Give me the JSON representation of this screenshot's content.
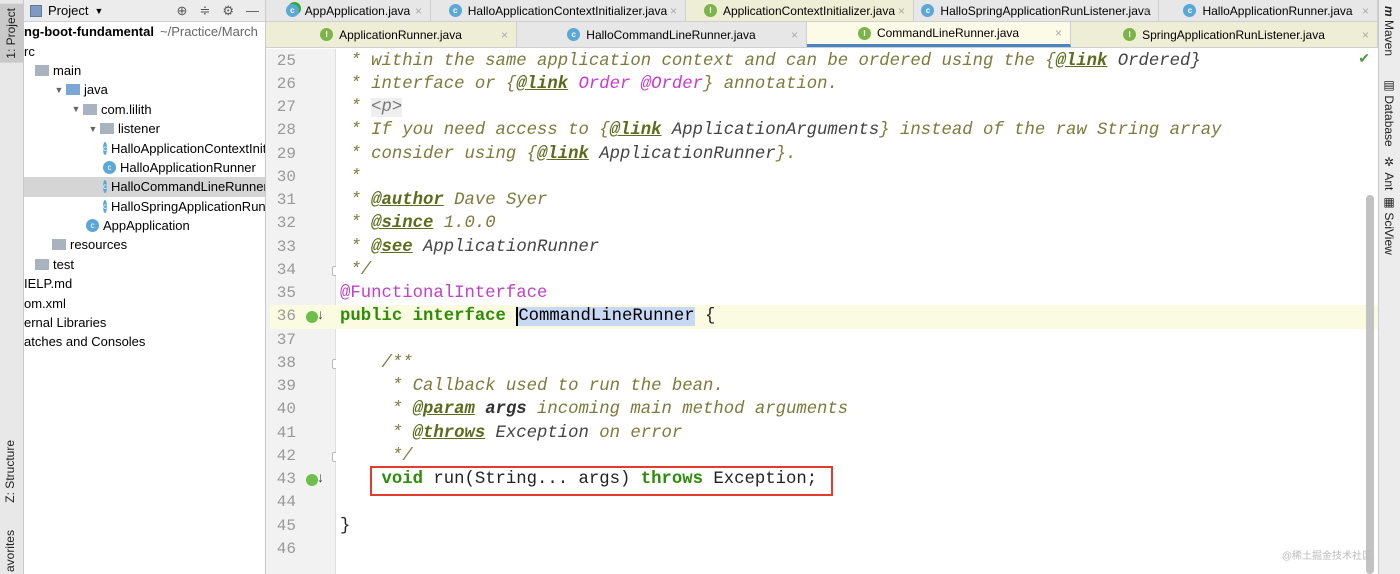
{
  "left_stripe": {
    "project": "1: Project",
    "structure": "Z: Structure",
    "favorites": "avorites"
  },
  "right_stripe": {
    "maven": "Maven",
    "database": "Database",
    "ant": "Ant",
    "sciview": "SciView"
  },
  "project_panel": {
    "title": "Project",
    "root": "ng-boot-fundamental",
    "root_path": "~/Practice/March",
    "items": [
      {
        "label": "rc",
        "indent": 0,
        "kind": "none"
      },
      {
        "label": "main",
        "indent": 1,
        "kind": "folder"
      },
      {
        "label": "java",
        "indent": 2,
        "kind": "folder-blue",
        "tri": "▼"
      },
      {
        "label": "com.lilith",
        "indent": 3,
        "kind": "folder",
        "tri": "▼"
      },
      {
        "label": "listener",
        "indent": 4,
        "kind": "folder",
        "tri": "▼"
      },
      {
        "label": "HalloApplicationContextInitializer",
        "indent": 5,
        "kind": "class"
      },
      {
        "label": "HalloApplicationRunner",
        "indent": 5,
        "kind": "class"
      },
      {
        "label": "HalloCommandLineRunner",
        "indent": 5,
        "kind": "class",
        "selected": true
      },
      {
        "label": "HalloSpringApplicationRunListener",
        "indent": 5,
        "kind": "class"
      },
      {
        "label": "AppApplication",
        "indent": 4,
        "kind": "app"
      },
      {
        "label": "resources",
        "indent": 2,
        "kind": "folder"
      },
      {
        "label": "test",
        "indent": 1,
        "kind": "folder"
      },
      {
        "label": "IELP.md",
        "indent": 0,
        "kind": "none"
      },
      {
        "label": "om.xml",
        "indent": 0,
        "kind": "none"
      },
      {
        "label": "ernal Libraries",
        "indent": 0,
        "kind": "none"
      },
      {
        "label": "atches and Consoles",
        "indent": 0,
        "kind": "none"
      }
    ]
  },
  "tabs_row1": [
    {
      "label": "AppApplication.java",
      "icon": "app",
      "width": 165
    },
    {
      "label": "HalloApplicationContextInitializer.java",
      "icon": "c",
      "width": 255
    },
    {
      "label": "ApplicationContextInitializer.java",
      "icon": "i",
      "width": 228,
      "iface": true
    },
    {
      "label": "HalloSpringApplicationRunListener.java",
      "icon": "c",
      "width": 245
    },
    {
      "label": "HalloApplicationRunner.java",
      "icon": "c",
      "width": 219
    }
  ],
  "tabs_row2": [
    {
      "label": "ApplicationRunner.java",
      "icon": "i",
      "width": 251,
      "iface": true
    },
    {
      "label": "HalloCommandLineRunner.java",
      "icon": "c",
      "width": 290
    },
    {
      "label": "CommandLineRunner.java",
      "icon": "i",
      "width": 264,
      "active": true
    },
    {
      "label": "SpringApplicationRunListener.java",
      "icon": "i",
      "width": 307,
      "iface": true
    }
  ],
  "editor": {
    "current_line": 36,
    "lines": [
      {
        "n": 25,
        "seg": [
          [
            " * within the same application context and can be ordered using the {",
            "cm"
          ],
          [
            "@link",
            "tag"
          ],
          [
            " Ordered}",
            "cmn"
          ]
        ]
      },
      {
        "n": 26,
        "seg": [
          [
            " * interface or {",
            "cm"
          ],
          [
            "@link",
            "tag"
          ],
          [
            " Order @Order",
            "ref"
          ],
          [
            "} annotation.",
            "cm"
          ]
        ]
      },
      {
        "n": 27,
        "seg": [
          [
            " * ",
            "cm"
          ],
          [
            "<p>",
            "html"
          ]
        ]
      },
      {
        "n": 28,
        "seg": [
          [
            " * If you need access to {",
            "cm"
          ],
          [
            "@link",
            "tag"
          ],
          [
            " ApplicationArguments",
            "cmn"
          ],
          [
            "} instead of the raw String array",
            "cm"
          ]
        ]
      },
      {
        "n": 29,
        "seg": [
          [
            " * consider using {",
            "cm"
          ],
          [
            "@link",
            "tag"
          ],
          [
            " ApplicationRunner",
            "cmn"
          ],
          [
            "}.",
            "cm"
          ]
        ]
      },
      {
        "n": 30,
        "seg": [
          [
            " *",
            "cm"
          ]
        ]
      },
      {
        "n": 31,
        "seg": [
          [
            " * ",
            "cm"
          ],
          [
            "@author",
            "tag"
          ],
          [
            " Dave Syer",
            "cm"
          ]
        ]
      },
      {
        "n": 32,
        "seg": [
          [
            " * ",
            "cm"
          ],
          [
            "@since",
            "tag"
          ],
          [
            " 1.0.0",
            "cm"
          ]
        ]
      },
      {
        "n": 33,
        "seg": [
          [
            " * ",
            "cm"
          ],
          [
            "@see",
            "tag"
          ],
          [
            " ApplicationRunner",
            "cmn"
          ]
        ]
      },
      {
        "n": 34,
        "seg": [
          [
            " */",
            "cm"
          ]
        ],
        "fold": true
      },
      {
        "n": 35,
        "seg": [
          [
            "@FunctionalInterface",
            "ann"
          ]
        ]
      },
      {
        "n": 36,
        "seg": [
          [
            "public interface ",
            "kw"
          ],
          [
            "CommandLineRunner",
            "hl"
          ],
          [
            " {",
            "pl"
          ]
        ],
        "marker": true
      },
      {
        "n": 37,
        "seg": []
      },
      {
        "n": 38,
        "seg": [
          [
            "    /**",
            "cm"
          ]
        ],
        "fold": true
      },
      {
        "n": 39,
        "seg": [
          [
            "     * Callback used to run the bean.",
            "cm"
          ]
        ]
      },
      {
        "n": 40,
        "seg": [
          [
            "     * ",
            "cm"
          ],
          [
            "@param",
            "tag"
          ],
          [
            " args",
            "cmb"
          ],
          [
            " incoming main method arguments",
            "cm"
          ]
        ]
      },
      {
        "n": 41,
        "seg": [
          [
            "     * ",
            "cm"
          ],
          [
            "@throws",
            "tag"
          ],
          [
            " Exception",
            "cmn"
          ],
          [
            " on error",
            "cm"
          ]
        ]
      },
      {
        "n": 42,
        "seg": [
          [
            "     */",
            "cm"
          ]
        ],
        "fold": true
      },
      {
        "n": 43,
        "seg": [
          [
            "    ",
            "pl"
          ],
          [
            "void",
            "kw"
          ],
          [
            " run(String... args) ",
            "pl"
          ],
          [
            "throws",
            "kw"
          ],
          [
            " Exception;",
            "pl"
          ]
        ],
        "marker": true
      },
      {
        "n": 44,
        "seg": []
      },
      {
        "n": 45,
        "seg": [
          [
            "}",
            "pl"
          ]
        ]
      },
      {
        "n": 46,
        "seg": []
      }
    ]
  },
  "watermark": "@稀土掘金技术社区",
  "colors": {
    "keyword": "#2d8c0a",
    "comment": "#7b7b3c",
    "annotation": "#c040c8",
    "highlight_box": "#e53b2c",
    "selection": "#c8d9f5"
  }
}
